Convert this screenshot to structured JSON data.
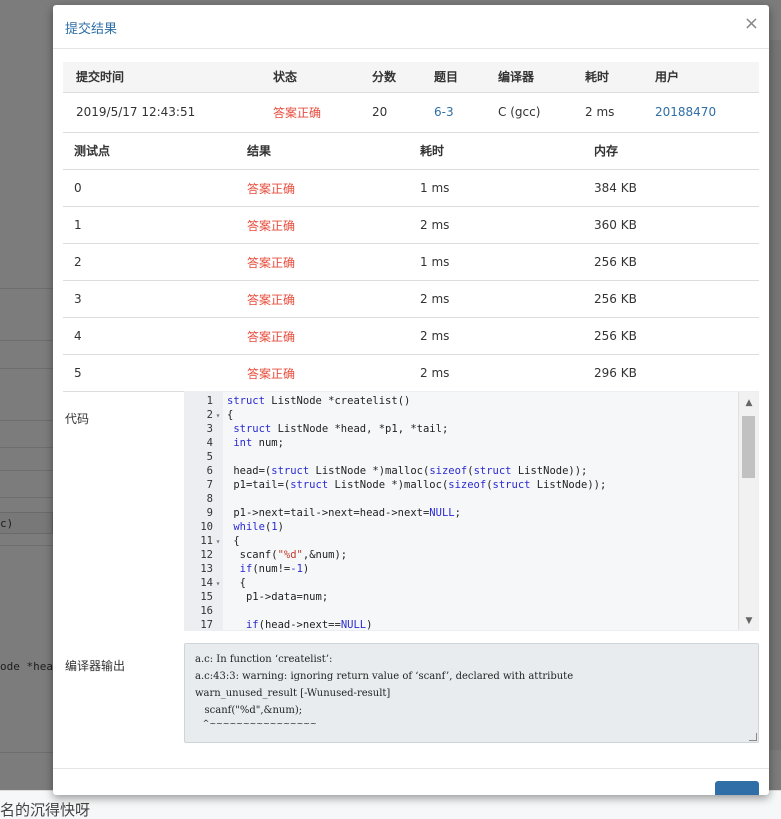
{
  "modal": {
    "title": "提交结果",
    "close_glyph": "×"
  },
  "summary": {
    "headers": [
      "提交时间",
      "状态",
      "分数",
      "题目",
      "编译器",
      "耗时",
      "用户"
    ],
    "row": {
      "time": "2019/5/17 12:43:51",
      "status": "答案正确",
      "score": "20",
      "problem": "6-3",
      "compiler": "C (gcc)",
      "duration": "2 ms",
      "user": "20188470"
    }
  },
  "cases": {
    "headers": [
      "测试点",
      "结果",
      "耗时",
      "内存"
    ],
    "rows": [
      {
        "id": "0",
        "result": "答案正确",
        "time": "1 ms",
        "memory": "384 KB"
      },
      {
        "id": "1",
        "result": "答案正确",
        "time": "2 ms",
        "memory": "360 KB"
      },
      {
        "id": "2",
        "result": "答案正确",
        "time": "1 ms",
        "memory": "256 KB"
      },
      {
        "id": "3",
        "result": "答案正确",
        "time": "2 ms",
        "memory": "256 KB"
      },
      {
        "id": "4",
        "result": "答案正确",
        "time": "2 ms",
        "memory": "256 KB"
      },
      {
        "id": "5",
        "result": "答案正确",
        "time": "2 ms",
        "memory": "296 KB"
      }
    ]
  },
  "code": {
    "label": "代码",
    "lines": [
      {
        "n": "1",
        "fold": "",
        "text": "struct ListNode *createlist()"
      },
      {
        "n": "2",
        "fold": "▾",
        "text": "{"
      },
      {
        "n": "3",
        "fold": "",
        "text": " struct ListNode *head, *p1, *tail;"
      },
      {
        "n": "4",
        "fold": "",
        "text": " int num;"
      },
      {
        "n": "5",
        "fold": "",
        "text": ""
      },
      {
        "n": "6",
        "fold": "",
        "text": " head=(struct ListNode *)malloc(sizeof(struct ListNode));"
      },
      {
        "n": "7",
        "fold": "",
        "text": " p1=tail=(struct ListNode *)malloc(sizeof(struct ListNode));"
      },
      {
        "n": "8",
        "fold": "",
        "text": ""
      },
      {
        "n": "9",
        "fold": "",
        "text": " p1->next=tail->next=head->next=NULL;"
      },
      {
        "n": "10",
        "fold": "",
        "text": " while(1)"
      },
      {
        "n": "11",
        "fold": "▾",
        "text": " {"
      },
      {
        "n": "12",
        "fold": "",
        "text": "  scanf(\"%d\",&num);"
      },
      {
        "n": "13",
        "fold": "",
        "text": "  if(num!=-1)"
      },
      {
        "n": "14",
        "fold": "▾",
        "text": "  {"
      },
      {
        "n": "15",
        "fold": "",
        "text": "   p1->data=num;"
      },
      {
        "n": "16",
        "fold": "",
        "text": ""
      },
      {
        "n": "17",
        "fold": "",
        "text": "   if(head->next==NULL)"
      }
    ]
  },
  "compiler_output": {
    "label": "编译器输出",
    "lines": [
      "a.c: In function ‘createlist’:",
      "a.c:43:3: warning: ignoring return value of ‘scanf’, declared with attribute",
      "warn_unused_result [-Wunused-result]",
      "   scanf(\"%d\",&num);",
      "   ^~~~~~~~~~~~~~~~~"
    ]
  },
  "background": {
    "snippet_code": "ode *hea",
    "snippet_box": "c)",
    "footer_text": "名的沉得快呀"
  },
  "colors": {
    "status_ok": "#e74c3c",
    "link": "#2f6ea6"
  }
}
